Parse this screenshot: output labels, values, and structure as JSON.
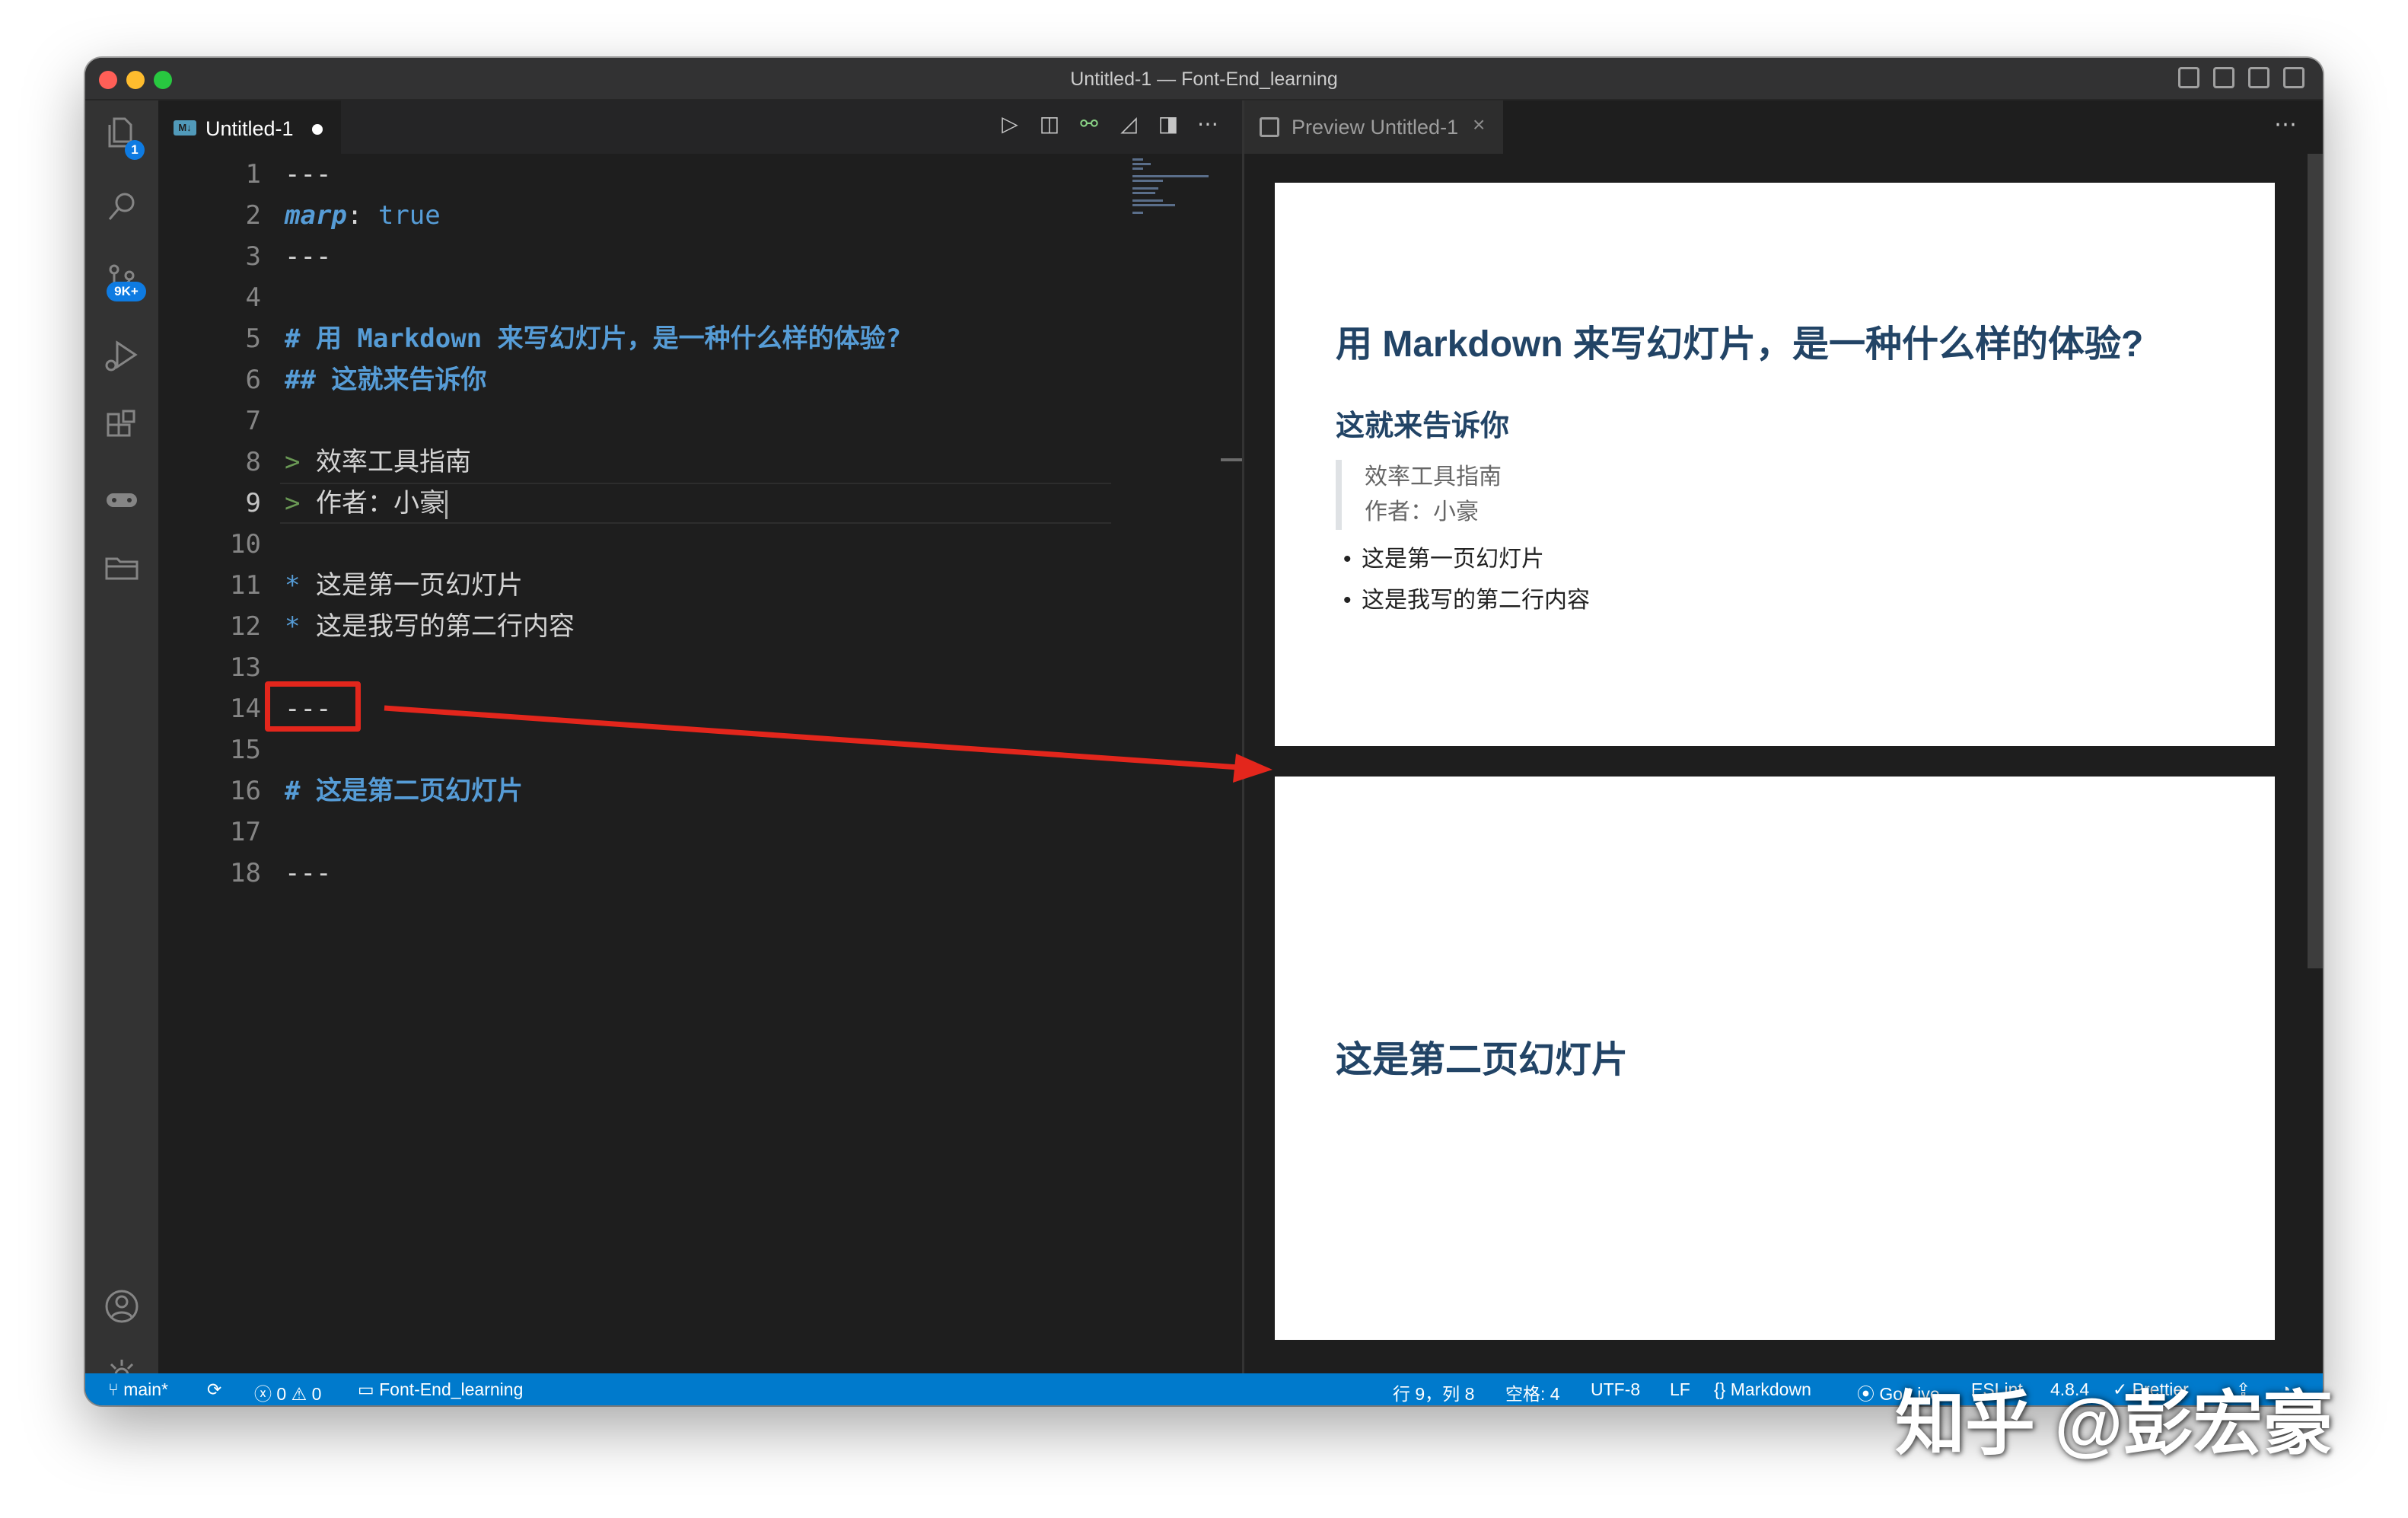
{
  "window": {
    "title": "Untitled-1 — Font-End_learning"
  },
  "activity_bar": {
    "explorer_badge": "1",
    "scm_badge": "9K+",
    "items": [
      "files-icon",
      "search-icon",
      "source-control-icon",
      "run-debug-icon",
      "extensions-icon",
      "remote-icon",
      "folder-icon"
    ]
  },
  "editor": {
    "tab_label": "Untitled-1",
    "file_badge": "M↓",
    "active_line": 9,
    "lines": [
      {
        "n": "1",
        "text": "---"
      },
      {
        "n": "2",
        "text": "marp: true"
      },
      {
        "n": "3",
        "text": "---"
      },
      {
        "n": "4",
        "text": ""
      },
      {
        "n": "5",
        "text": "# 用 Markdown 来写幻灯片，是一种什么样的体验?"
      },
      {
        "n": "6",
        "text": "## 这就来告诉你"
      },
      {
        "n": "7",
        "text": ""
      },
      {
        "n": "8",
        "text": "> 效率工具指南"
      },
      {
        "n": "9",
        "text": "> 作者：小豪"
      },
      {
        "n": "10",
        "text": ""
      },
      {
        "n": "11",
        "text": "* 这是第一页幻灯片"
      },
      {
        "n": "12",
        "text": "* 这是我写的第二行内容"
      },
      {
        "n": "13",
        "text": ""
      },
      {
        "n": "14",
        "text": "---"
      },
      {
        "n": "15",
        "text": ""
      },
      {
        "n": "16",
        "text": "# 这是第二页幻灯片"
      },
      {
        "n": "17",
        "text": ""
      },
      {
        "n": "18",
        "text": "---"
      }
    ]
  },
  "preview": {
    "tab_label": "Preview Untitled-1",
    "slide1": {
      "h1": "用 Markdown 来写幻灯片，是一种什么样的体验?",
      "h2": "这就来告诉你",
      "quote_line1": "效率工具指南",
      "quote_line2": "作者：小豪",
      "bullets": [
        "这是第一页幻灯片",
        "这是我写的第二行内容"
      ]
    },
    "slide2": {
      "h1": "这是第二页幻灯片"
    }
  },
  "status_bar": {
    "branch": "main*",
    "errors": "0",
    "warnings": "0",
    "folder": "Font-End_learning",
    "position": "行 9，列 8",
    "spaces": "空格: 4",
    "encoding": "UTF-8",
    "eol": "LF",
    "language": "Markdown",
    "golive": "Go Live",
    "eslint": "ESLint",
    "version": "4.8.4",
    "prettier": "Prettier"
  },
  "watermark": "知乎 @彭宏豪",
  "colors": {
    "accent_blue": "#007acc",
    "heading_blue": "#569cd6",
    "quote_green": "#6a9955",
    "annotation_red": "#e3261c",
    "slide_heading": "#224466"
  }
}
